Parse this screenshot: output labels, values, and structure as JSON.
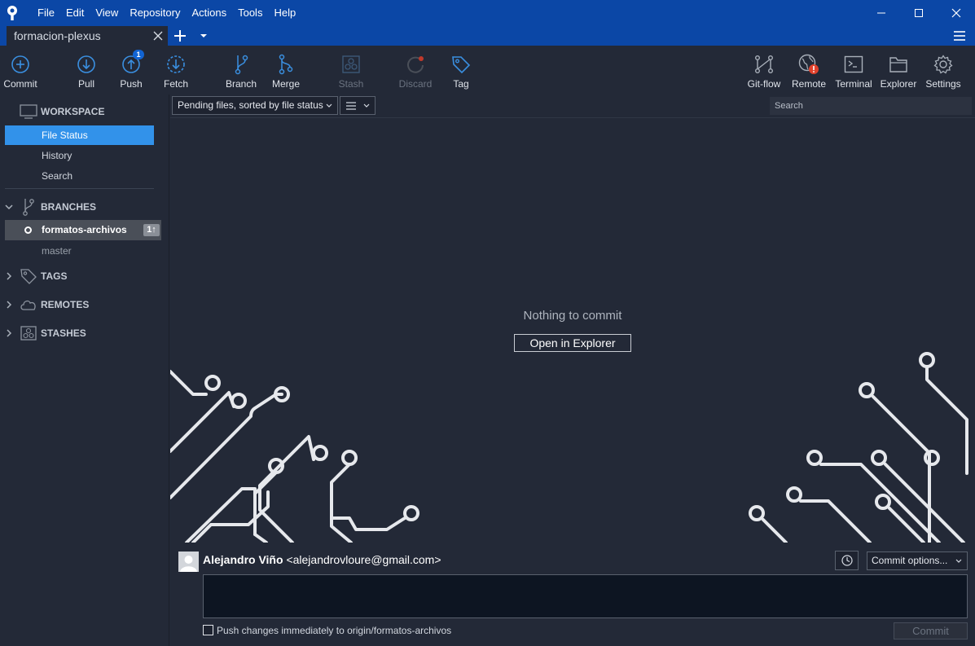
{
  "menu": [
    "File",
    "Edit",
    "View",
    "Repository",
    "Actions",
    "Tools",
    "Help"
  ],
  "tab": {
    "title": "formacion-plexus"
  },
  "toolbar": {
    "commit": "Commit",
    "pull": "Pull",
    "push": "Push",
    "push_badge": "1",
    "fetch": "Fetch",
    "branch": "Branch",
    "merge": "Merge",
    "stash": "Stash",
    "discard": "Discard",
    "tag": "Tag",
    "gitflow": "Git-flow",
    "remote": "Remote",
    "terminal": "Terminal",
    "explorer": "Explorer",
    "settings": "Settings"
  },
  "sidebar": {
    "workspace": "WORKSPACE",
    "items": [
      "File Status",
      "History",
      "Search"
    ],
    "branches": "BRANCHES",
    "current_branch": "formatos-archivos",
    "current_branch_ahead": "1↑",
    "other_branch": "master",
    "tags": "TAGS",
    "remotes": "REMOTES",
    "stashes": "STASHES"
  },
  "main": {
    "sort_label": "Pending files, sorted by file status",
    "search_placeholder": "Search",
    "empty_message": "Nothing to commit",
    "open_explorer": "Open in Explorer"
  },
  "commit": {
    "author_name": "Alejandro Viño",
    "author_email": "<alejandrovloure@gmail.com>",
    "options": "Commit options...",
    "push_label": "Push changes immediately to origin/formatos-archivos",
    "button": "Commit"
  },
  "colors": {
    "title_bar": "#0b47a6",
    "background": "#232937",
    "selection": "#3292ea",
    "badge": "#1264d3",
    "remote_alert": "#e0412c"
  }
}
